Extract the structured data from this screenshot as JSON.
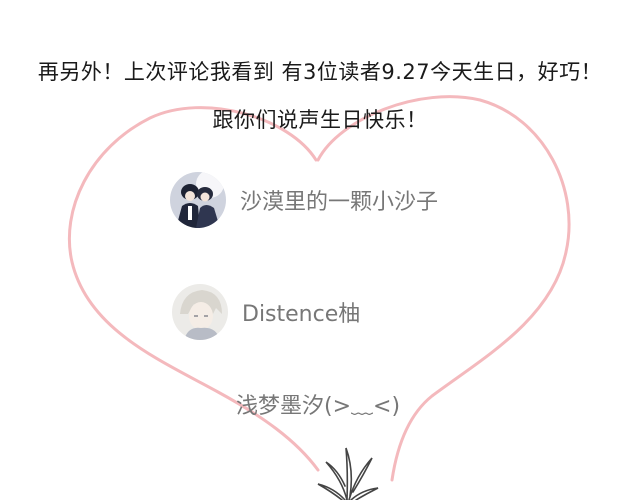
{
  "announcement": {
    "line1": "再另外！上次评论我看到 有3位读者9.27今天生日，好巧！",
    "line2": "跟你们说声生日快乐！"
  },
  "users": [
    {
      "name": "沙漠里的一颗小沙子",
      "avatar": "anime-couple-avatar"
    },
    {
      "name": "Distence柚",
      "avatar": "anime-boy-avatar"
    },
    {
      "name": "浅梦墨汐(>﹏<)"
    }
  ],
  "colors": {
    "heart": "#f4b9bd",
    "text": "#1a1a1a",
    "username": "#777777"
  },
  "decorations": {
    "heart": "heart-outline-icon",
    "plant": "plant-sketch-icon"
  }
}
